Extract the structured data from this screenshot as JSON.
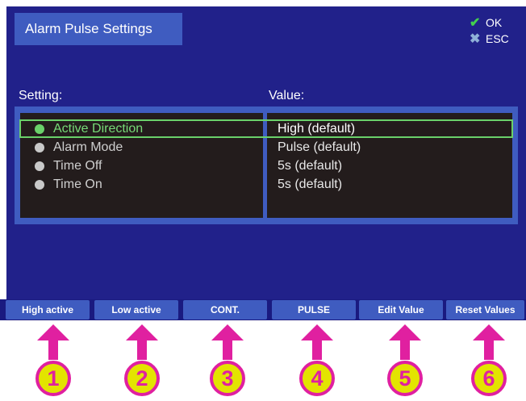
{
  "dialog": {
    "title": "Alarm Pulse Settings"
  },
  "actions": {
    "ok_label": "OK",
    "esc_label": "ESC"
  },
  "table": {
    "setting_header": "Setting:",
    "value_header": "Value:",
    "rows": [
      {
        "label": "Active Direction",
        "value": "High (default)",
        "selected": true
      },
      {
        "label": "Alarm Mode",
        "value": "Pulse (default)",
        "selected": false
      },
      {
        "label": "Time Off",
        "value": "5s (default)",
        "selected": false
      },
      {
        "label": "Time On",
        "value": "5s (default)",
        "selected": false
      }
    ]
  },
  "function_keys": [
    {
      "label": "High active",
      "number": "1"
    },
    {
      "label": "Low active",
      "number": "2"
    },
    {
      "label": "CONT.",
      "number": "3"
    },
    {
      "label": "PULSE",
      "number": "4"
    },
    {
      "label": "Edit Value",
      "number": "5"
    },
    {
      "label": "Reset Values",
      "number": "6"
    }
  ],
  "colors": {
    "screen_bg": "#21218a",
    "panel_accent": "#3f5cc0",
    "selection_green": "#6ad16a",
    "callout_magenta": "#e020a0",
    "callout_yellow": "#e3e400"
  }
}
